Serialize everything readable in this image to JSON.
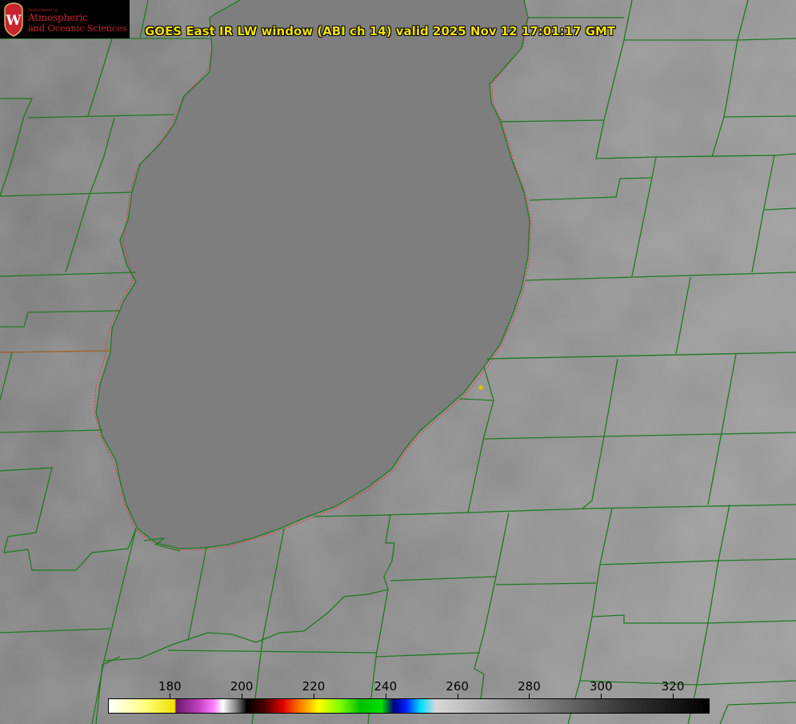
{
  "title": "GOES East IR LW window (ABI ch 14) valid 2025 Nov 12 17:01:17 GMT",
  "logo": {
    "department_line": "Department of",
    "line1": "Atmospheric",
    "line2": "and Oceanic Sciences",
    "seal_letter": "W"
  },
  "colorbar": {
    "ticks": [
      {
        "label": "180",
        "value": 180
      },
      {
        "label": "200",
        "value": 200
      },
      {
        "label": "220",
        "value": 220
      },
      {
        "label": "240",
        "value": 240
      },
      {
        "label": "260",
        "value": 260
      },
      {
        "label": "280",
        "value": 280
      },
      {
        "label": "300",
        "value": 300
      },
      {
        "label": "320",
        "value": 320
      }
    ],
    "min_value": 163,
    "max_value": 330
  },
  "colors": {
    "title_text": "#f0e000",
    "boundaries": "#1f7a1f",
    "shoreline": "#e03a3a",
    "station_marker": "#d4c400",
    "logo_red": "#c8242f"
  }
}
